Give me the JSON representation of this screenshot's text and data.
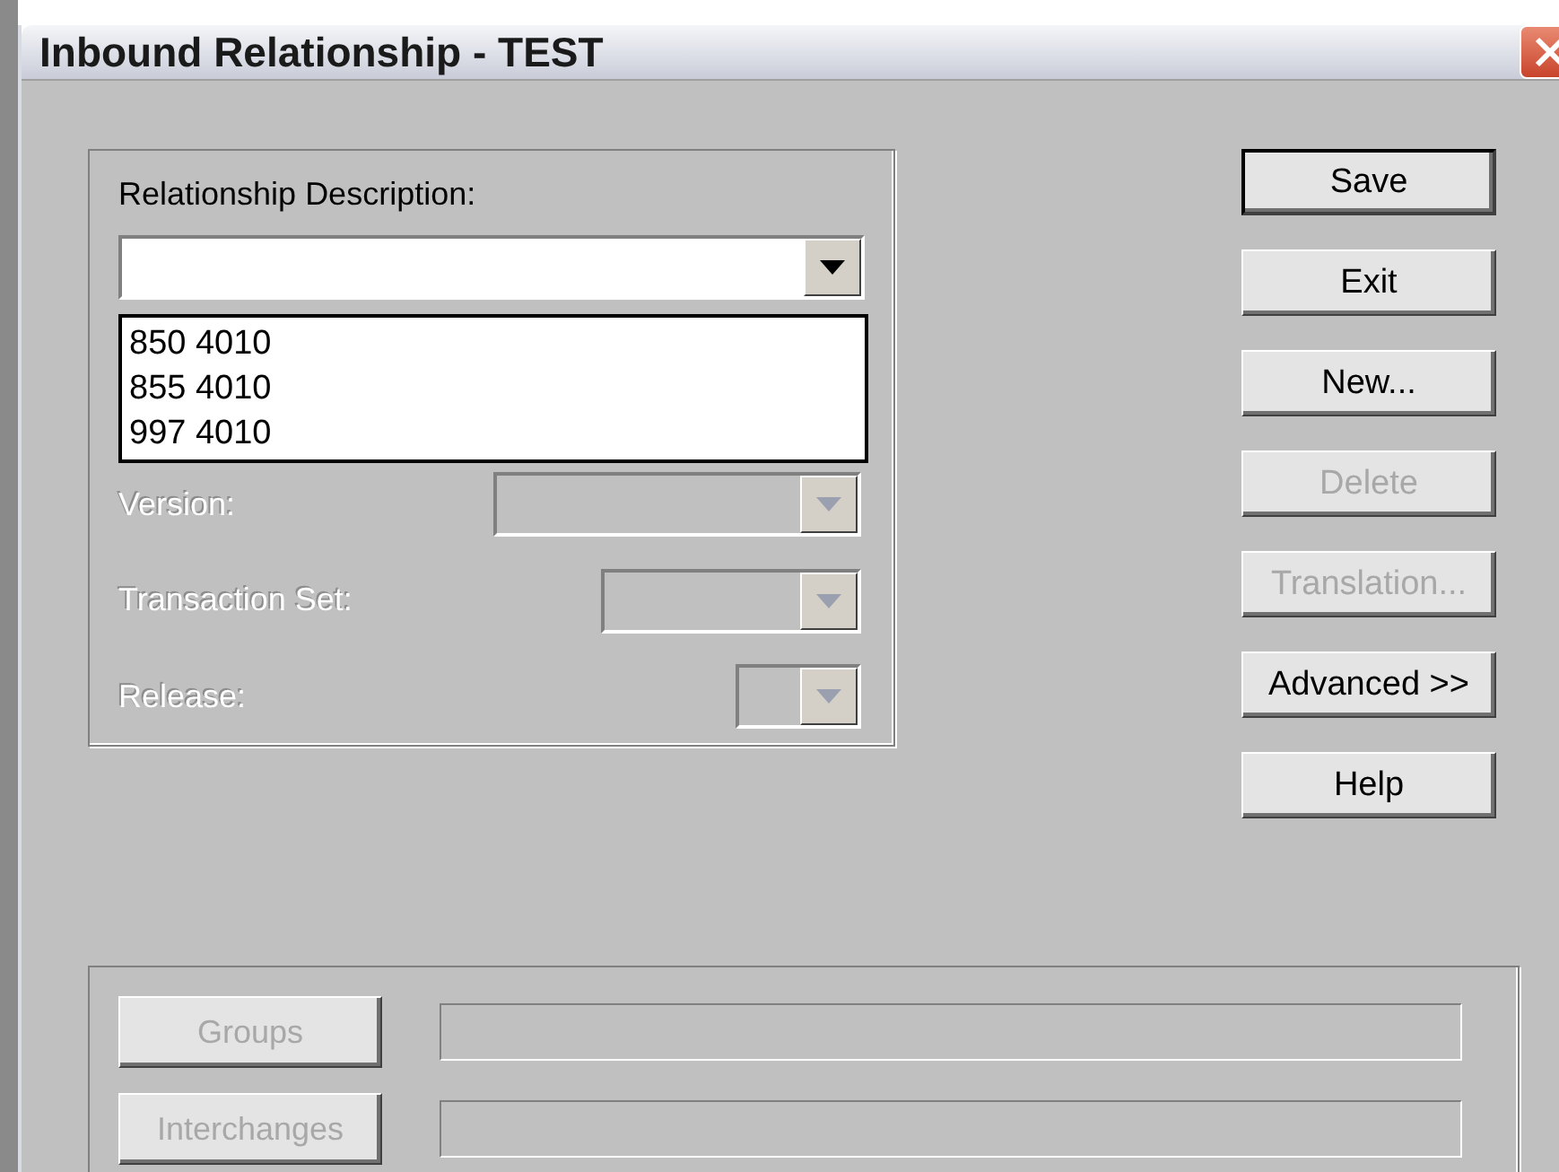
{
  "window": {
    "title": "Inbound Relationship - TEST"
  },
  "description": {
    "label": "Relationship Description:",
    "expanded": true,
    "options": [
      {
        "label": "850 4010",
        "selected": false
      },
      {
        "label": "855 4010",
        "selected": false
      },
      {
        "label": "997 4010",
        "selected": false
      }
    ]
  },
  "fields": [
    {
      "label": "Version:",
      "disabled": true
    },
    {
      "label": "Transaction Set:",
      "disabled": true
    },
    {
      "label": "Release:",
      "disabled": true
    }
  ],
  "buttons": [
    {
      "label": "Save",
      "default": true,
      "disabled": false
    },
    {
      "label": "Exit",
      "default": false,
      "disabled": false
    },
    {
      "label": "New...",
      "default": false,
      "disabled": false
    },
    {
      "label": "Delete",
      "default": false,
      "disabled": true
    },
    {
      "label": "Translation...",
      "default": false,
      "disabled": true
    },
    {
      "label": "Advanced >>",
      "default": false,
      "disabled": false
    },
    {
      "label": "Help",
      "default": false,
      "disabled": false
    }
  ],
  "envelope": [
    {
      "label": "Groups",
      "disabled": true
    },
    {
      "label": "Interchanges",
      "disabled": true
    }
  ]
}
